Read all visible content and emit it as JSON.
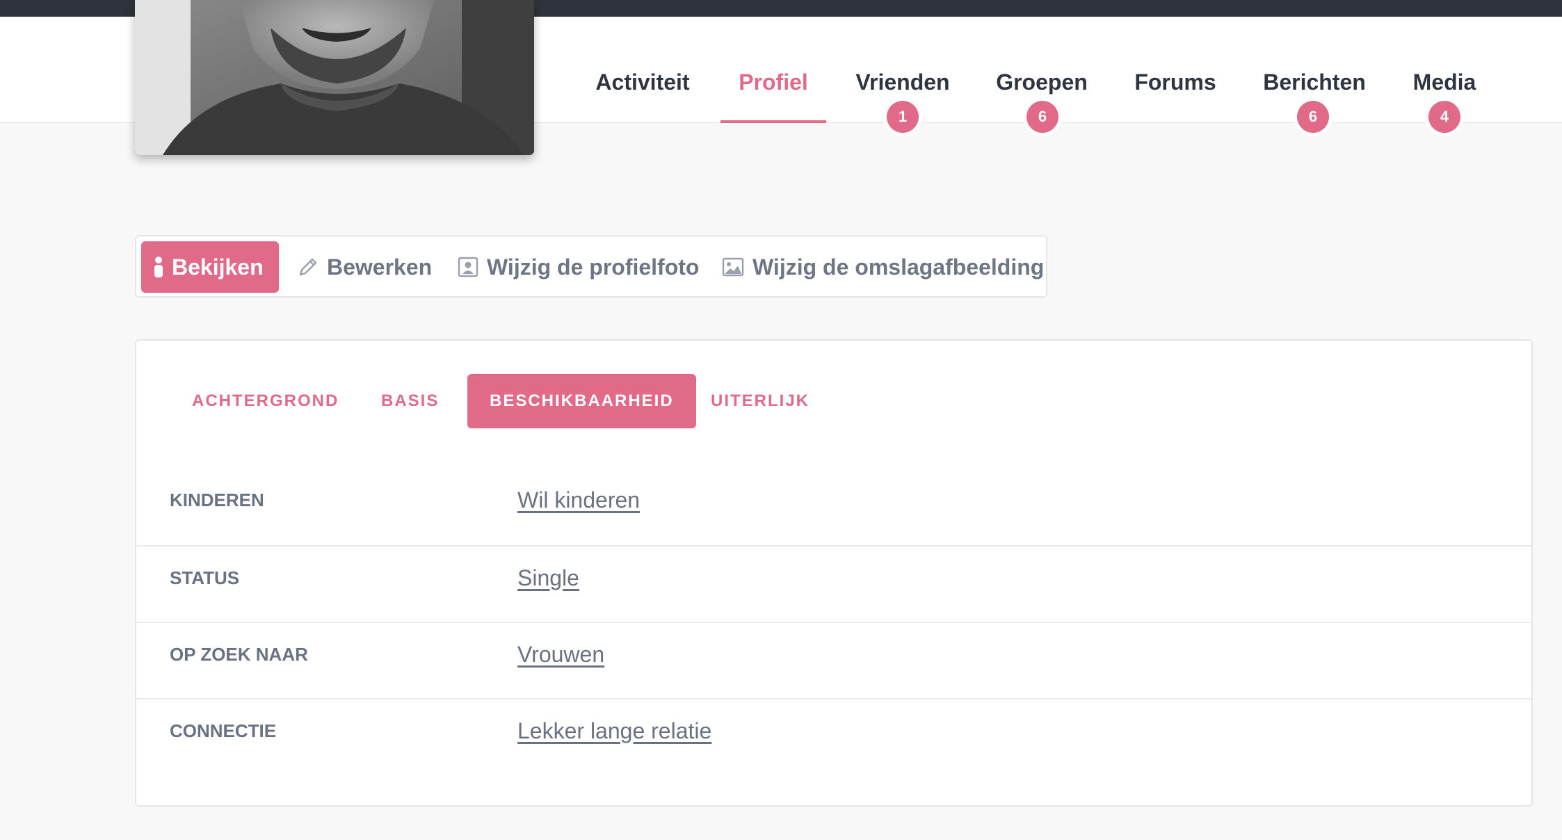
{
  "nav": {
    "items": [
      {
        "label": "Activiteit",
        "badge": null
      },
      {
        "label": "Profiel",
        "badge": null,
        "active": true
      },
      {
        "label": "Vrienden",
        "badge": "1"
      },
      {
        "label": "Groepen",
        "badge": "6"
      },
      {
        "label": "Forums",
        "badge": null
      },
      {
        "label": "Berichten",
        "badge": "6"
      },
      {
        "label": "Media",
        "badge": "4"
      }
    ]
  },
  "actions": {
    "view": "Bekijken",
    "edit": "Bewerken",
    "change_photo": "Wijzig de profielfoto",
    "change_cover": "Wijzig de omslagafbeelding"
  },
  "tabs": [
    {
      "label": "ACHTERGROND"
    },
    {
      "label": "BASIS"
    },
    {
      "label": "BESCHIKBAARHEID",
      "active": true
    },
    {
      "label": "UITERLIJK"
    }
  ],
  "fields": [
    {
      "label": "KINDEREN",
      "value": "Wil kinderen"
    },
    {
      "label": "STATUS",
      "value": "Single"
    },
    {
      "label": "OP ZOEK NAAR",
      "value": "Vrouwen"
    },
    {
      "label": "CONNECTIE",
      "value": "Lekker lange relatie"
    }
  ],
  "colors": {
    "accent": "#e06a88",
    "topbar": "#2f333b",
    "muted_text": "#6e7583",
    "nav_text": "#2f3540"
  },
  "icons": {
    "view": "info-icon",
    "edit": "pencil-icon",
    "change_photo": "profile-photo-icon",
    "change_cover": "image-icon"
  }
}
